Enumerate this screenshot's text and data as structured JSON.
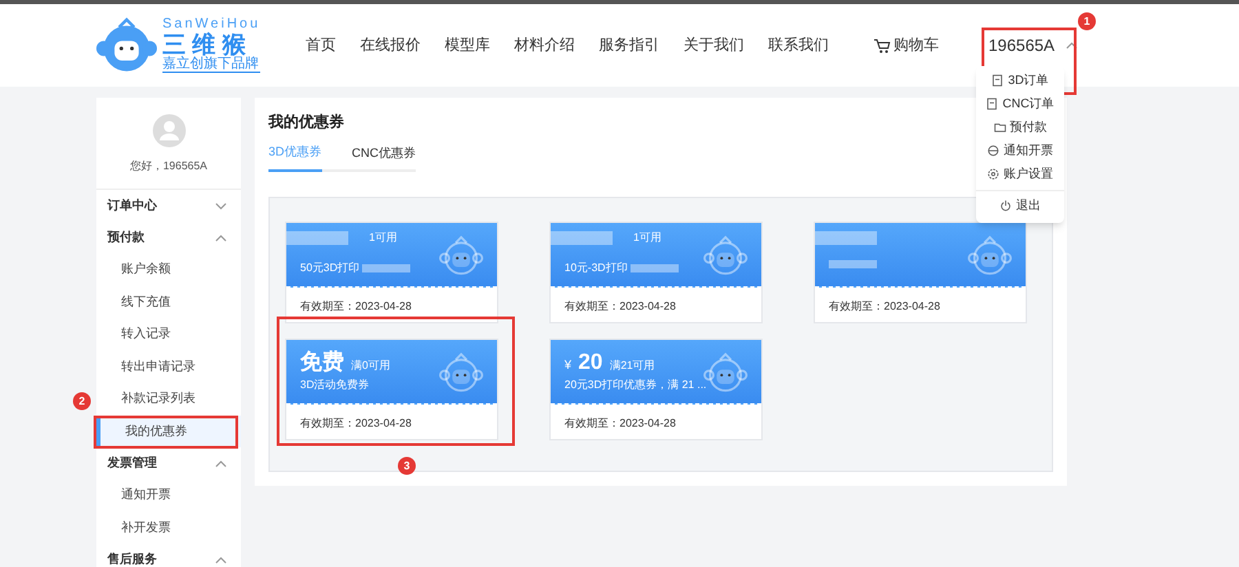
{
  "logo": {
    "brand_latin": "SanWeiHou",
    "brand": "三 维 猴",
    "tagline": "嘉立创旗下品牌"
  },
  "nav": [
    {
      "label": "首页"
    },
    {
      "label": "在线报价"
    },
    {
      "label": "模型库"
    },
    {
      "label": "材料介绍"
    },
    {
      "label": "服务指引"
    },
    {
      "label": "关于我们"
    },
    {
      "label": "联系我们"
    }
  ],
  "cart": {
    "label": "购物车"
  },
  "user_menu": {
    "username": "196565A",
    "expanded": true,
    "items": [
      {
        "label": "3D订单",
        "kind": "doc"
      },
      {
        "label": "CNC订单",
        "kind": "doc"
      },
      {
        "label": "预付款",
        "kind": "folder"
      },
      {
        "label": "通知开票",
        "kind": "globe"
      },
      {
        "label": "账户设置",
        "kind": "gear"
      },
      {
        "label": "退出",
        "kind": "power"
      }
    ]
  },
  "sidebar": {
    "greeting": "您好，196565A",
    "groups": [
      {
        "label": "订单中心",
        "expanded": false
      },
      {
        "label": "预付款",
        "expanded": true,
        "items": [
          {
            "label": "账户余额",
            "selected": false
          },
          {
            "label": "线下充值",
            "selected": false
          },
          {
            "label": "转入记录",
            "selected": false
          },
          {
            "label": "转出申请记录",
            "selected": false
          },
          {
            "label": "补款记录列表",
            "selected": false
          },
          {
            "label": "我的优惠券",
            "selected": true
          }
        ]
      },
      {
        "label": "发票管理",
        "expanded": true,
        "items": [
          {
            "label": "通知开票",
            "selected": false
          },
          {
            "label": "补开发票",
            "selected": false
          }
        ]
      },
      {
        "label": "售后服务",
        "expanded": true
      }
    ]
  },
  "main": {
    "title": "我的优惠券",
    "tabs": [
      {
        "label": "3D优惠券",
        "selected": true
      },
      {
        "label": "CNC优惠券",
        "selected": false
      }
    ],
    "coupons": [
      {
        "condition": "1可用",
        "description": "50元3D打印",
        "validity": "有效期至：2023-04-28",
        "redacted": true
      },
      {
        "condition": "1可用",
        "description": "10元-3D打印",
        "validity": "有效期至：2023-04-28",
        "redacted": true
      },
      {
        "validity": "有效期至：2023-04-28",
        "redacted": true
      },
      {
        "amount": "免费",
        "condition": "满0可用",
        "description": "3D活动免费券",
        "validity": "有效期至：2023-04-28",
        "redacted": false
      },
      {
        "currency": "¥",
        "amount": "20",
        "condition": "满21可用",
        "description": "20元3D打印优惠券，满 21 ...",
        "validity": "有效期至：2023-04-28",
        "redacted": false
      }
    ]
  },
  "annotations": [
    {
      "number": "1"
    },
    {
      "number": "2"
    },
    {
      "number": "3"
    }
  ]
}
